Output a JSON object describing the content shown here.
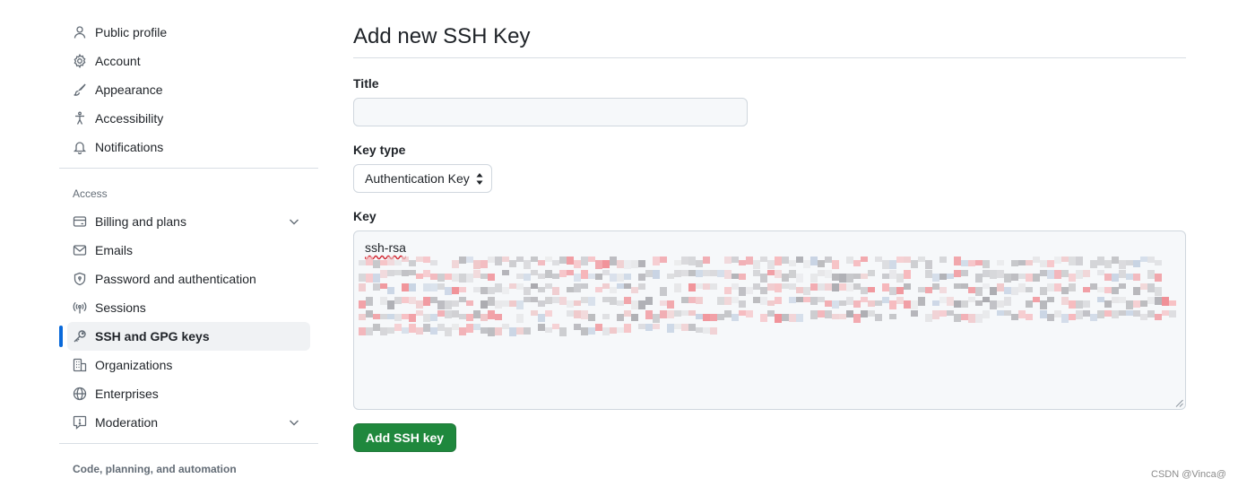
{
  "sidebar": {
    "items": [
      {
        "label": "Public profile",
        "icon": "person-icon"
      },
      {
        "label": "Account",
        "icon": "gear-icon"
      },
      {
        "label": "Appearance",
        "icon": "paintbrush-icon"
      },
      {
        "label": "Accessibility",
        "icon": "accessibility-icon"
      },
      {
        "label": "Notifications",
        "icon": "bell-icon"
      }
    ],
    "access_heading": "Access",
    "access_items": [
      {
        "label": "Billing and plans",
        "icon": "credit-card-icon",
        "expandable": true
      },
      {
        "label": "Emails",
        "icon": "mail-icon"
      },
      {
        "label": "Password and authentication",
        "icon": "shield-lock-icon"
      },
      {
        "label": "Sessions",
        "icon": "broadcast-icon"
      },
      {
        "label": "SSH and GPG keys",
        "icon": "key-icon",
        "active": true
      },
      {
        "label": "Organizations",
        "icon": "organization-icon"
      },
      {
        "label": "Enterprises",
        "icon": "globe-icon"
      },
      {
        "label": "Moderation",
        "icon": "report-icon",
        "expandable": true
      }
    ],
    "code_heading": "Code, planning, and automation"
  },
  "form": {
    "page_title": "Add new SSH Key",
    "title_label": "Title",
    "title_value": "",
    "key_type_label": "Key type",
    "key_type_value": "Authentication Key",
    "key_label": "Key",
    "key_prefix": "ssh-rsa",
    "submit_label": "Add SSH key"
  },
  "watermark": "CSDN @Vinca@",
  "colors": {
    "accent": "#0969da",
    "submit_button": "#1f883d",
    "active_nav_bg": "#f0f2f4",
    "border": "#d0d7de"
  }
}
